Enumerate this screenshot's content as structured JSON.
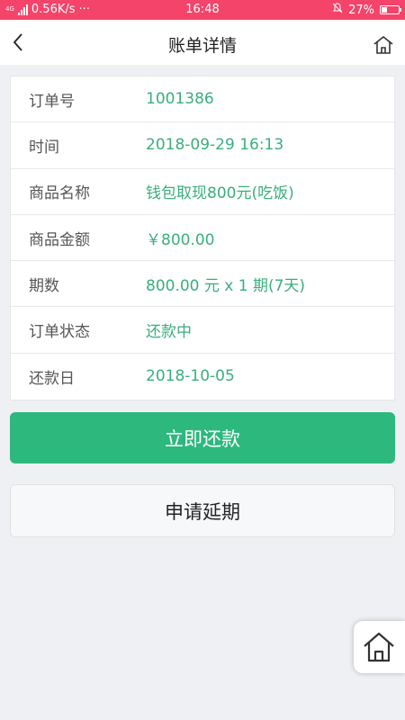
{
  "status_bar": {
    "network_tag": "4G",
    "speed": "0.56K/s",
    "dots": "···",
    "time": "16:48",
    "battery": "27%"
  },
  "header": {
    "title": "账单详情"
  },
  "details": [
    {
      "label": "订单号",
      "value": "1001386"
    },
    {
      "label": "时间",
      "value": "2018-09-29 16:13"
    },
    {
      "label": "商品名称",
      "value": "钱包取现800元(吃饭)"
    },
    {
      "label": "商品金额",
      "value": "￥800.00"
    },
    {
      "label": "期数",
      "value": "800.00 元 x 1 期(7天)"
    },
    {
      "label": "订单状态",
      "value": "还款中"
    },
    {
      "label": "还款日",
      "value": "2018-10-05"
    }
  ],
  "actions": {
    "repay_label": "立即还款",
    "extend_label": "申请延期"
  },
  "colors": {
    "status_bar": "#f4446a",
    "accent_green": "#2db87d",
    "value_text": "#3aae7c",
    "background": "#eef0f3"
  },
  "icons": {
    "back": "chevron-left-icon",
    "home": "home-icon",
    "float_home": "home-icon"
  }
}
